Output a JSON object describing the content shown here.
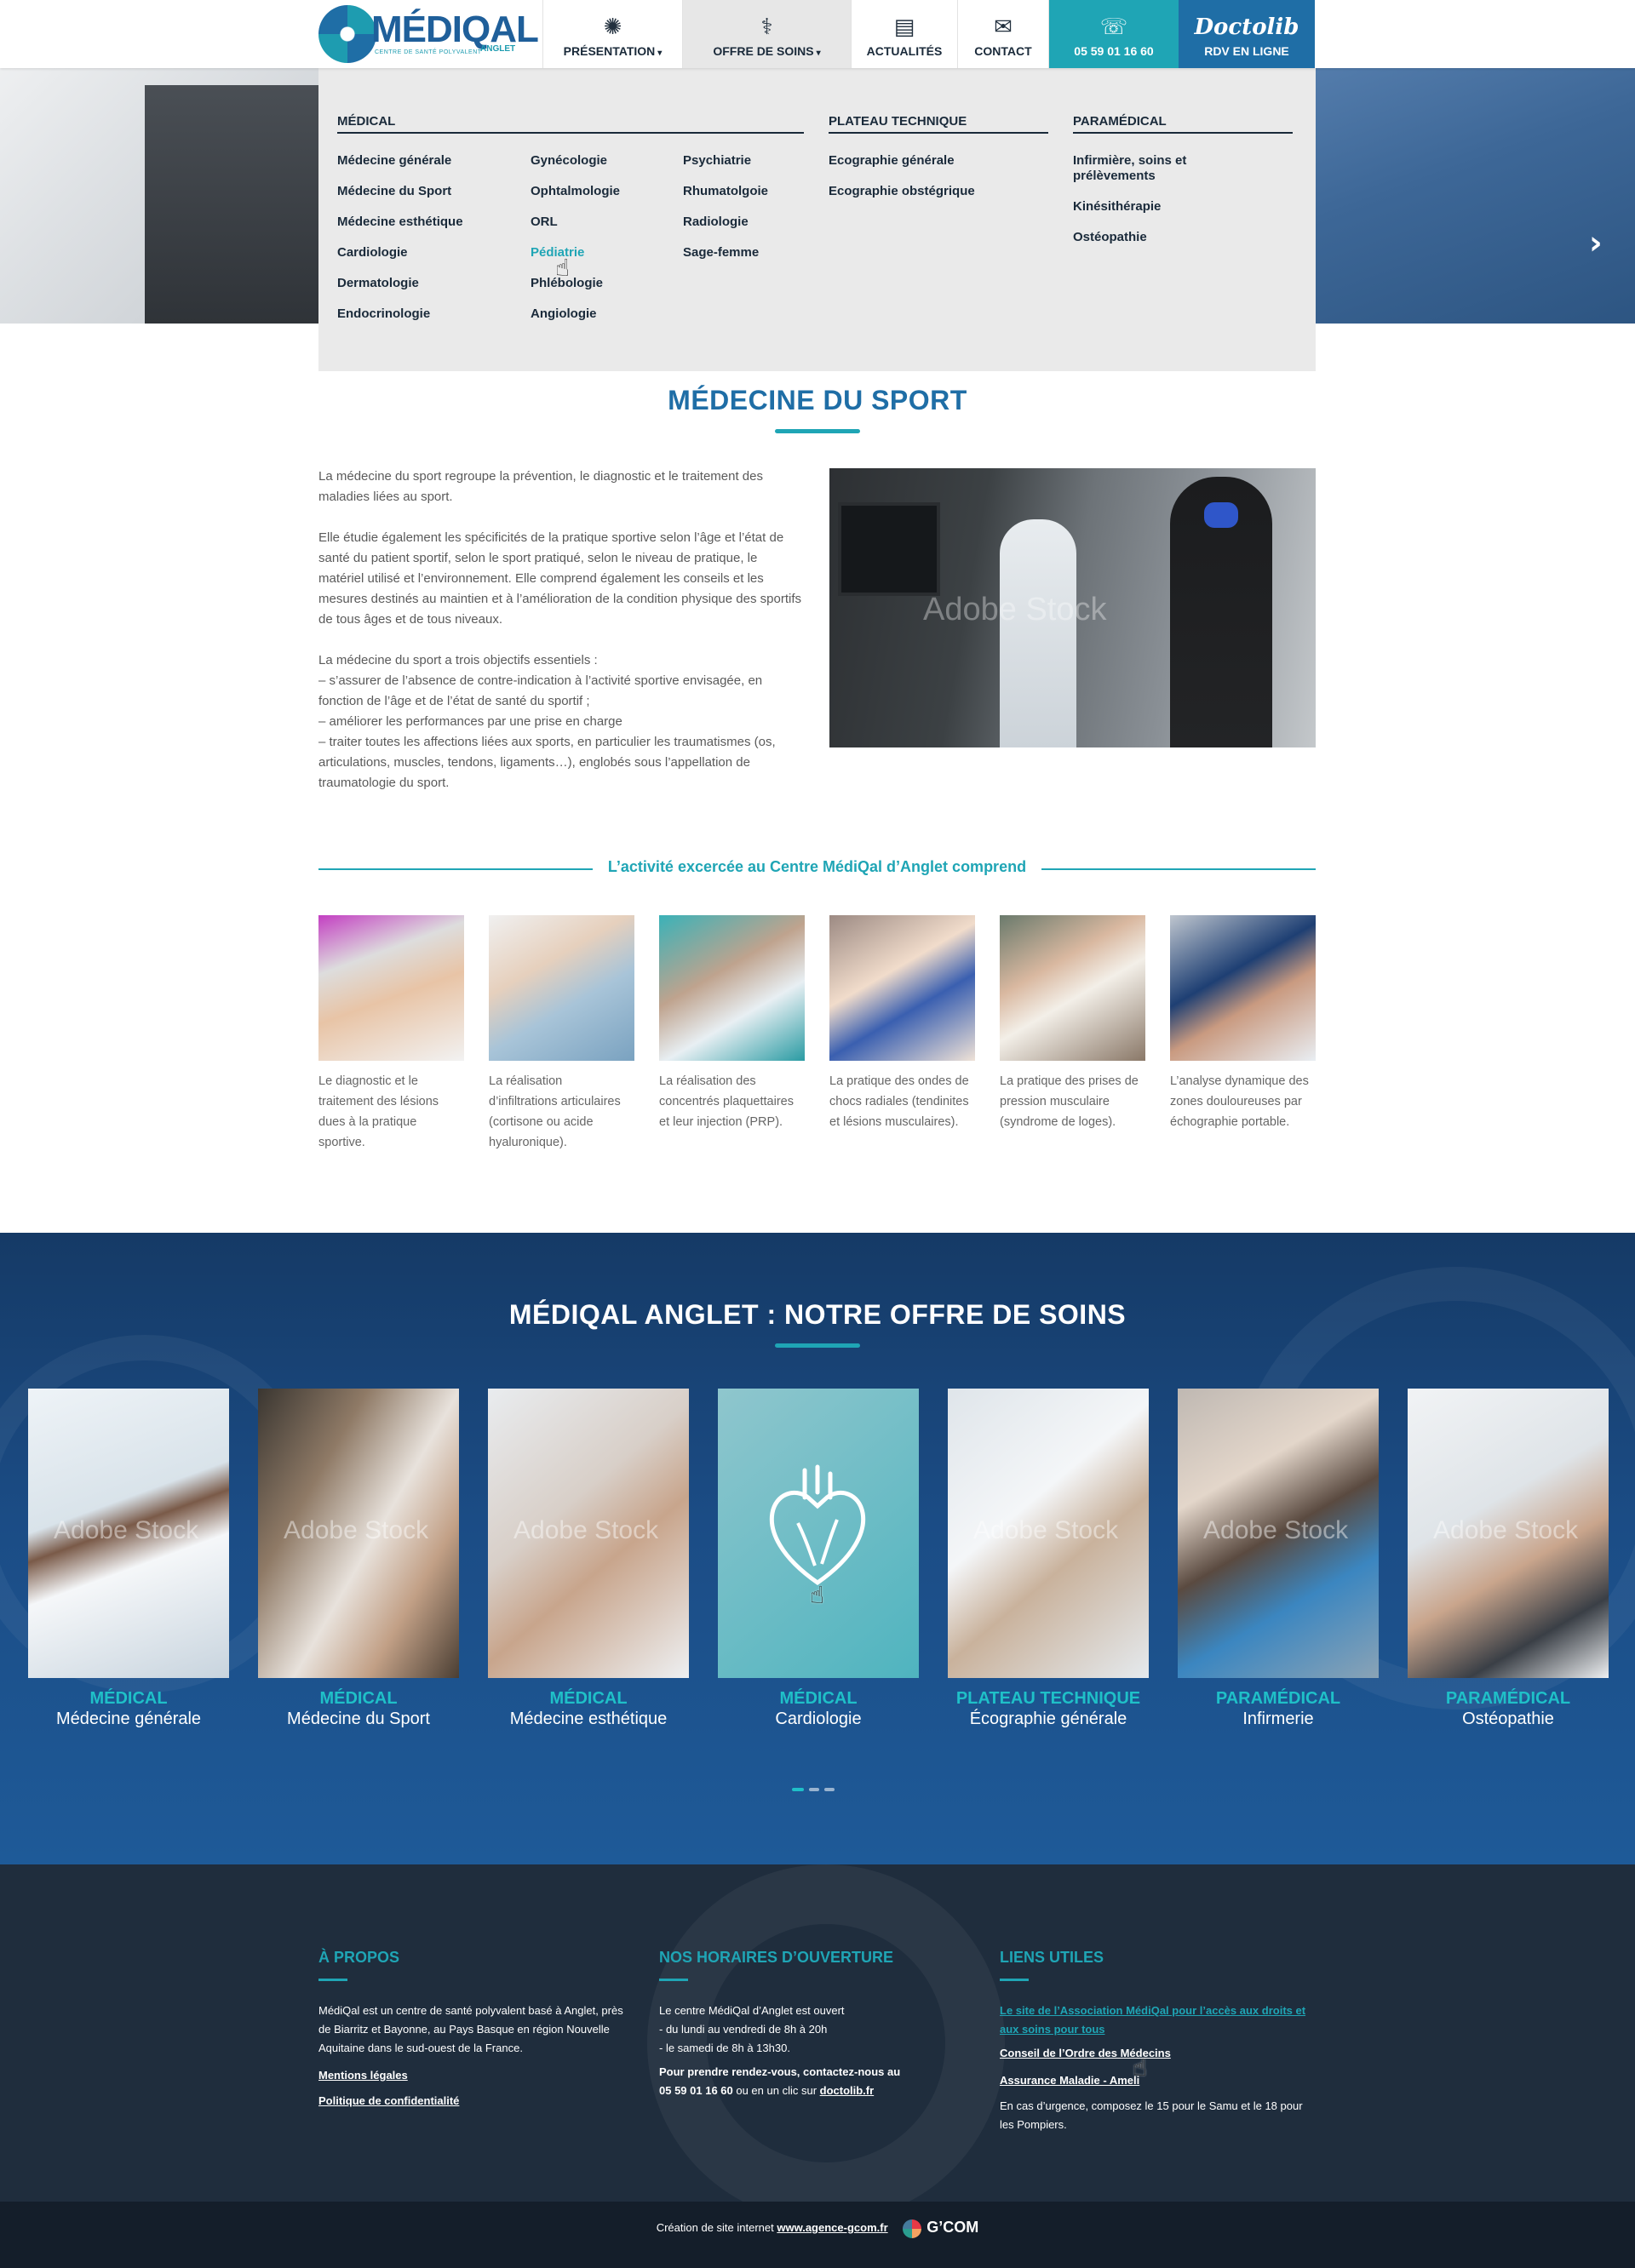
{
  "header": {
    "logo": {
      "name": "MÉDIQAL",
      "subtitle": "CENTRE DE SANTÉ POLYVALENT",
      "town": "ANGLET"
    },
    "nav": [
      {
        "label": "PRÉSENTATION",
        "icon": "leaf-emblem-icon"
      },
      {
        "label": "OFFRE DE SOINS",
        "icon": "stethoscope-icon"
      },
      {
        "label": "ACTUALITÉS",
        "icon": "clipboard-icon"
      },
      {
        "label": "CONTACT",
        "icon": "envelope-icon"
      }
    ],
    "phone": "05 59 01 16 60",
    "doctolib_logo": "Doctolib",
    "rdv_label": "RDV EN LIGNE"
  },
  "mega_menu": {
    "medical_heading": "MÉDICAL",
    "medical_col1": [
      "Médecine générale",
      "Médecine du Sport",
      "Médecine esthétique",
      "Cardiologie",
      "Dermatologie",
      "Endocrinologie"
    ],
    "medical_col2": [
      "Gynécologie",
      "Ophtalmologie",
      "ORL",
      "Pédiatrie",
      "Phlébologie",
      "Angiologie"
    ],
    "medical_col3": [
      "Psychiatrie",
      "Rhumatolgoie",
      "Radiologie",
      "Sage-femme"
    ],
    "plateau_heading": "PLATEAU TECHNIQUE",
    "plateau_items": [
      "Ecographie générale",
      "Ecographie obstégrique"
    ],
    "paramedical_heading": "PARAMÉDICAL",
    "paramedical_items": [
      "Infirmière, soins et prélèvements",
      "Kinésithérapie",
      "Ostéopathie"
    ],
    "active_item": "Pédiatrie"
  },
  "main": {
    "title": "MÉDECINE DU SPORT",
    "paragraphs": [
      "La médecine du sport regroupe la prévention, le diagnostic et le traitement des maladies liées au sport.",
      "Elle étudie également les spécificités de la pratique sportive selon l’âge et l’état de santé du patient sportif, selon le sport pratiqué, selon le niveau de pratique, le matériel utilisé et l’environnement. Elle comprend également les conseils et les mesures destinés au maintien et à l’amélioration de la condition physique des sportifs de tous âges et de tous niveaux."
    ],
    "objectives_intro": "La médecine du sport a trois objectifs essentiels :",
    "objectives": [
      "– s’assurer de l’absence de contre-indication à l’activité sportive envisagée, en fonction de l’âge et de l’état de santé du sportif ;",
      "– améliorer les performances par une prise en charge",
      "– traiter toutes les affections liées aux sports, en particulier les traumatismes (os, articulations, muscles, tendons, ligaments…), englobés sous l’appellation de traumatologie du sport."
    ],
    "image_watermark": "Adobe Stock",
    "activities_title": "L’activité excercée au Centre MédiQal d’Anglet comprend",
    "activities": [
      "Le diagnostic et le traitement des lésions dues à la pratique sportive.",
      "La réalisation d’infiltrations articulaires (cortisone ou acide hyaluronique).",
      "La réalisation des concentrés plaquettaires et leur injection (PRP).",
      "La pratique des ondes de chocs radiales (tendinites et lésions musculaires).",
      "La pratique des prises de pression musculaire (syndrome de loges).",
      "L’analyse dynamique des zones douloureuses par échographie portable."
    ]
  },
  "offre": {
    "title": "MÉDIQAL ANGLET : NOTRE OFFRE DE SOINS",
    "watermark": "Adobe Stock",
    "cards": [
      {
        "category": "MÉDICAL",
        "name": "Médecine générale"
      },
      {
        "category": "MÉDICAL",
        "name": "Médecine du Sport"
      },
      {
        "category": "MÉDICAL",
        "name": "Médecine esthétique"
      },
      {
        "category": "MÉDICAL",
        "name": "Cardiologie"
      },
      {
        "category": "PLATEAU TECHNIQUE",
        "name": "Écographie générale"
      },
      {
        "category": "PARAMÉDICAL",
        "name": "Infirmerie"
      },
      {
        "category": "PARAMÉDICAL",
        "name": "Ostéopathie"
      }
    ],
    "colors": {
      "accent": "#1fc0c8",
      "band": "#1b4c85"
    }
  },
  "footer": {
    "about": {
      "heading": "À PROPOS",
      "text": "MédiQal est un centre de santé polyvalent basé à Anglet, près de Biarritz et Bayonne, au Pays Basque en région Nouvelle Aquitaine dans le sud-ouest de la France.",
      "links": [
        "Mentions légales",
        "Politique de confidentialité"
      ]
    },
    "hours": {
      "heading": "NOS HORAIRES D’OUVERTURE",
      "lines": [
        "Le centre MédiQal d’Anglet est ouvert",
        "- du lundi au vendredi de 8h à 20h",
        "- le samedi de 8h à 13h30."
      ],
      "rdv_intro": "Pour prendre rendez-vous, contactez-nous au",
      "phone": "05 59 01 16 60",
      "rdv_mid": " ou en un clic sur ",
      "doctolib_link": "doctolib.fr"
    },
    "links": {
      "heading": "LIENS UTILES",
      "items": [
        "Le site de l’Association MédiQal pour l’accès aux droits et aux soins pour tous",
        "Conseil de l’Ordre des Médecins",
        "Assurance Maladie - Ameli"
      ],
      "emergency": "En cas d’urgence, composez le 15 pour le Samu et le 18 pour les Pompiers."
    }
  },
  "credit": {
    "text": "Création de site internet ",
    "link": "www.agence-gcom.fr",
    "brand": "G’COM"
  },
  "colors": {
    "teal": "#1fa5b5",
    "blue": "#1f6ea6",
    "footer": "#1f2d3d"
  }
}
